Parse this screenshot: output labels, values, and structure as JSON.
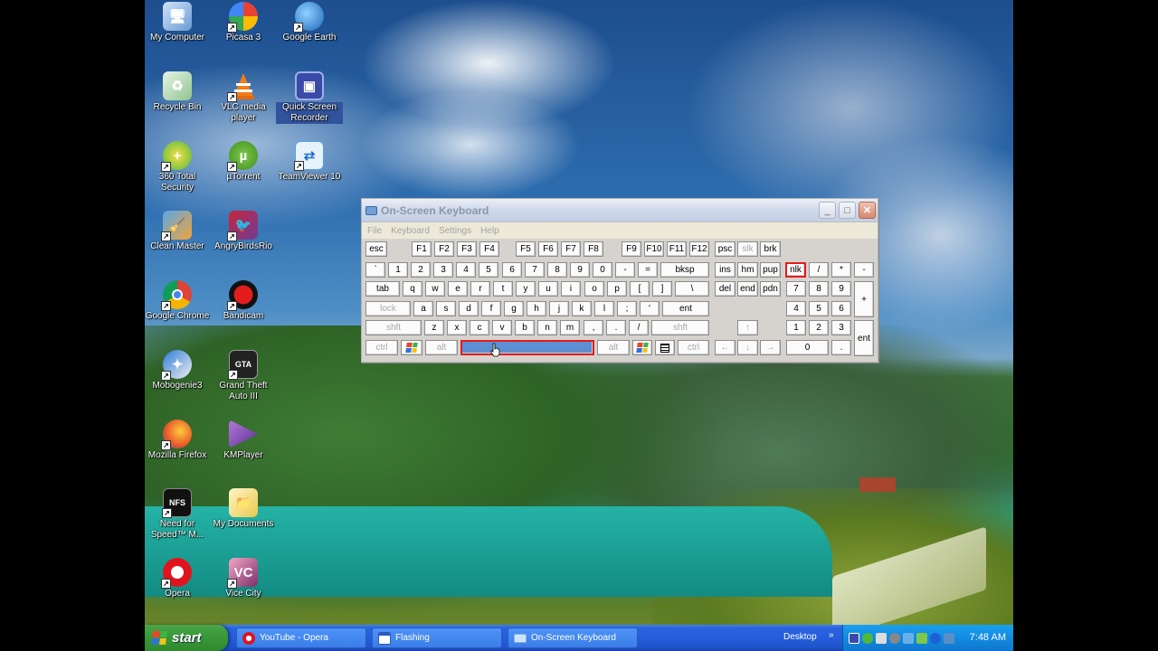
{
  "desktop_icons": [
    {
      "label": "My Computer"
    },
    {
      "label": "Picasa 3"
    },
    {
      "label": "Google Earth"
    },
    {
      "label": "Recycle Bin"
    },
    {
      "label": "VLC media player"
    },
    {
      "label": "Quick Screen Recorder"
    },
    {
      "label": "360 Total Security"
    },
    {
      "label": "µTorrent"
    },
    {
      "label": "TeamViewer 10"
    },
    {
      "label": "Clean Master"
    },
    {
      "label": "AngryBirdsRio"
    },
    {
      "label": "Google Chrome"
    },
    {
      "label": "Bandicam"
    },
    {
      "label": "Mobogenie3"
    },
    {
      "label": "Grand Theft Auto III"
    },
    {
      "label": "Mozilla Firefox"
    },
    {
      "label": "KMPlayer"
    },
    {
      "label": "Need for Speed™ M..."
    },
    {
      "label": "My Documents"
    },
    {
      "label": "Opera"
    },
    {
      "label": "Vice City"
    }
  ],
  "osk": {
    "title": "On-Screen Keyboard",
    "menu": [
      "File",
      "Keyboard",
      "Settings",
      "Help"
    ],
    "keys": {
      "esc": "esc",
      "f1": "F1",
      "f2": "F2",
      "f3": "F3",
      "f4": "F4",
      "f5": "F5",
      "f6": "F6",
      "f7": "F7",
      "f8": "F8",
      "f9": "F9",
      "f10": "F10",
      "f11": "F11",
      "f12": "F12",
      "psc": "psc",
      "slk": "slk",
      "brk": "brk",
      "grave": "`",
      "n1": "1",
      "n2": "2",
      "n3": "3",
      "n4": "4",
      "n5": "5",
      "n6": "6",
      "n7": "7",
      "n8": "8",
      "n9": "9",
      "n0": "0",
      "minus": "-",
      "equal": "=",
      "bksp": "bksp",
      "ins": "ins",
      "hm": "hm",
      "pup": "pup",
      "nlk": "nlk",
      "kp_div": "/",
      "kp_mul": "*",
      "kp_sub": "-",
      "tab": "tab",
      "q": "q",
      "w": "w",
      "e": "e",
      "r": "r",
      "t": "t",
      "y": "y",
      "u": "u",
      "i": "i",
      "o": "o",
      "p": "p",
      "lbr": "[",
      "rbr": "]",
      "bslash": "\\",
      "del": "del",
      "end": "end",
      "pdn": "pdn",
      "kp7": "7",
      "kp8": "8",
      "kp9": "9",
      "kp_add": "+",
      "lock": "lock",
      "a": "a",
      "s": "s",
      "d": "d",
      "f": "f",
      "g": "g",
      "h": "h",
      "j": "j",
      "k": "k",
      "l": "l",
      "semi": ";",
      "quote": "'",
      "ent": "ent",
      "kp4": "4",
      "kp5": "5",
      "kp6": "6",
      "lshift": "shft",
      "z": "z",
      "x": "x",
      "c": "c",
      "v": "v",
      "b": "b",
      "n": "n",
      "m": "m",
      "comma": ",",
      "period": ".",
      "slash": "/",
      "rshift": "shft",
      "up": "↑",
      "kp1": "1",
      "kp2": "2",
      "kp3": "3",
      "kp_ent": "ent",
      "lctrl": "ctrl",
      "lalt": "alt",
      "ralt": "alt",
      "rctrl": "ctrl",
      "left": "←",
      "down": "↓",
      "right": "→",
      "kp0": "0",
      "kp_dot": "."
    }
  },
  "taskbar": {
    "start": "start",
    "items": [
      "YouTube - Opera",
      "Flashing",
      "On-Screen Keyboard"
    ],
    "desktop": "Desktop",
    "clock": "7:48 AM"
  }
}
